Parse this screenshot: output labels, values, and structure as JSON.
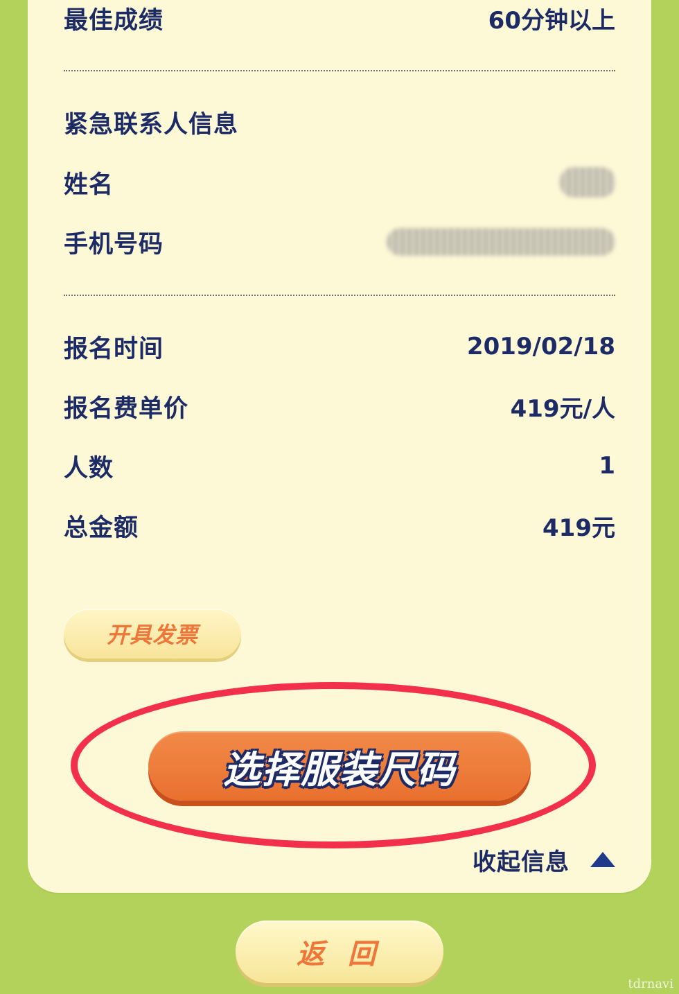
{
  "result": {
    "best_label": "最佳成绩",
    "best_value": "60分钟以上"
  },
  "emergency": {
    "section_title": "紧急联系人信息",
    "name_label": "姓名",
    "phone_label": "手机号码"
  },
  "registration": {
    "time_label": "报名时间",
    "time_value": "2019/02/18",
    "fee_label": "报名费单价",
    "fee_value": "419元/人",
    "count_label": "人数",
    "count_value": "1",
    "total_label": "总金额",
    "total_value": "419元"
  },
  "buttons": {
    "invoice": "开具发票",
    "select_size": "选择服装尺码",
    "collapse": "收起信息",
    "back": "返 回"
  },
  "watermark": "tdrnavi",
  "colors": {
    "background": "#b3d25c",
    "card": "#fdf8d6",
    "text": "#1c2a66",
    "accent_orange": "#e9702f",
    "highlight_ring": "#f2304b"
  },
  "icons": {
    "collapse_icon": "triangle-up-icon"
  }
}
